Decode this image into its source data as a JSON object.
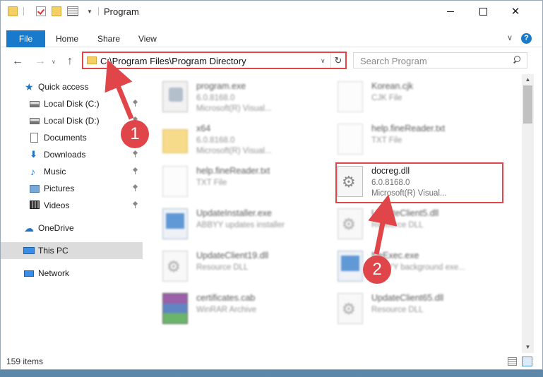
{
  "window": {
    "title": "Program",
    "close_glyph": "✕"
  },
  "ribbon": {
    "file": "File",
    "home": "Home",
    "share": "Share",
    "view": "View"
  },
  "address": {
    "path": "C:\\Program Files\\Program Directory",
    "refresh_glyph": "↻"
  },
  "search": {
    "placeholder": "Search Program"
  },
  "nav": {
    "back_glyph": "←",
    "forward_glyph": "→",
    "up_glyph": "↑",
    "items": [
      {
        "label": "Quick access",
        "icon": "star-icon"
      },
      {
        "label": "Local Disk (C:)",
        "icon": "disk-icon",
        "pinned": true
      },
      {
        "label": "Local Disk (D:)",
        "icon": "disk-icon",
        "pinned": true
      },
      {
        "label": "Documents",
        "icon": "document-icon",
        "pinned": true
      },
      {
        "label": "Downloads",
        "icon": "download-icon",
        "pinned": true
      },
      {
        "label": "Music",
        "icon": "music-icon",
        "pinned": true
      },
      {
        "label": "Pictures",
        "icon": "pictures-icon",
        "pinned": true
      },
      {
        "label": "Videos",
        "icon": "videos-icon",
        "pinned": true
      },
      {
        "label": "OneDrive",
        "icon": "cloud-icon"
      },
      {
        "label": "This PC",
        "icon": "computer-icon",
        "selected": true
      },
      {
        "label": "Network",
        "icon": "network-icon"
      }
    ]
  },
  "files": [
    {
      "name": "program.exe",
      "line2": "6.0.8168.0",
      "line3": "Microsoft(R) Visual..."
    },
    {
      "name": "Korean.cjk",
      "line2": "CJK File",
      "line3": ""
    },
    {
      "name": "x64",
      "line2": "6.0.8168.0",
      "line3": "Microsoft(R) Visual..."
    },
    {
      "name": "help.fineReader.txt",
      "line2": "TXT File",
      "line3": ""
    },
    {
      "name": "help.fineReader.txt",
      "line2": "TXT File",
      "line3": ""
    },
    {
      "name": "docreg.dll",
      "line2": "6.0.8168.0",
      "line3": "Microsoft(R) Visual..."
    },
    {
      "name": "UpdateInstaller.exe",
      "line2": "ABBYY updates installer",
      "line3": ""
    },
    {
      "name": "UpdateClient5.dll",
      "line2": "Resource DLL",
      "line3": ""
    },
    {
      "name": "UpdateClient19.dll",
      "line2": "Resource DLL",
      "line3": ""
    },
    {
      "name": "NeExec.exe",
      "line2": "ABBYY background exe...",
      "line3": ""
    },
    {
      "name": "certificates.cab",
      "line2": "WinRAR Archive",
      "line3": ""
    },
    {
      "name": "UpdateClient65.dll",
      "line2": "Resource DLL",
      "line3": ""
    }
  ],
  "status": {
    "count": "159 items"
  },
  "annotations": {
    "step1": "1",
    "step2": "2",
    "color": "#e0454a"
  }
}
